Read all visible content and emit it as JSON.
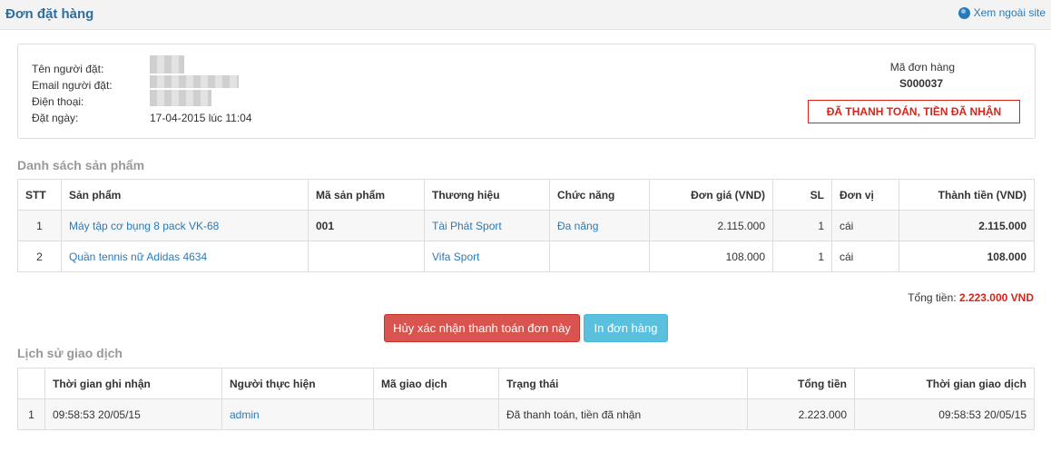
{
  "header": {
    "title": "Đơn đặt hàng",
    "site_link": "Xem ngoài site"
  },
  "customer": {
    "name_label": "Tên người đặt:",
    "email_label": "Email người đặt:",
    "phone_label": "Điện thoại:",
    "date_label": "Đặt ngày:",
    "date_value": "17-04-2015 lúc 11:04"
  },
  "order": {
    "code_label": "Mã đơn hàng",
    "code": "S000037",
    "status": "ĐÃ THANH TOÁN, TIỀN ĐÃ NHẬN"
  },
  "products": {
    "section_title": "Danh sách sản phẩm",
    "columns": [
      "STT",
      "Sản phẩm",
      "Mã sản phẩm",
      "Thương hiệu",
      "Chức năng",
      "Đơn giá (VND)",
      "SL",
      "Đơn vị",
      "Thành tiền (VND)"
    ],
    "rows": [
      {
        "stt": "1",
        "name": "Máy tập cơ bụng 8 pack VK-68",
        "code": "001",
        "brand": "Tài Phát Sport",
        "function": "Đa năng",
        "price": "2.115.000",
        "qty": "1",
        "unit": "cái",
        "amount": "2.115.000"
      },
      {
        "stt": "2",
        "name": "Quần tennis nữ Adidas 4634",
        "code": "",
        "brand": "Vifa Sport",
        "function": "",
        "price": "108.000",
        "qty": "1",
        "unit": "cái",
        "amount": "108.000"
      }
    ],
    "total_label": "Tổng tiền:",
    "total_value": "2.223.000 VND"
  },
  "actions": {
    "cancel_label": "Hủy xác nhận thanh toán đơn này",
    "print_label": "In đơn hàng"
  },
  "history": {
    "section_title": "Lịch sử giao dịch",
    "columns": [
      "",
      "Thời gian ghi nhận",
      "Người thực hiện",
      "Mã giao dịch",
      "Trạng thái",
      "Tổng tiền",
      "Thời gian giao dịch"
    ],
    "rows": [
      {
        "stt": "1",
        "recorded": "09:58:53 20/05/15",
        "user": "admin",
        "txn": "",
        "status": "Đã thanh toán, tiền đã nhận",
        "total": "2.223.000",
        "txn_time": "09:58:53 20/05/15"
      }
    ]
  },
  "colors": {
    "title_blue": "#2f6fa0",
    "link_blue": "#2a7ab8",
    "status_red": "#d9241c",
    "danger_button": "#d9534f",
    "info_button": "#5bc0de"
  }
}
